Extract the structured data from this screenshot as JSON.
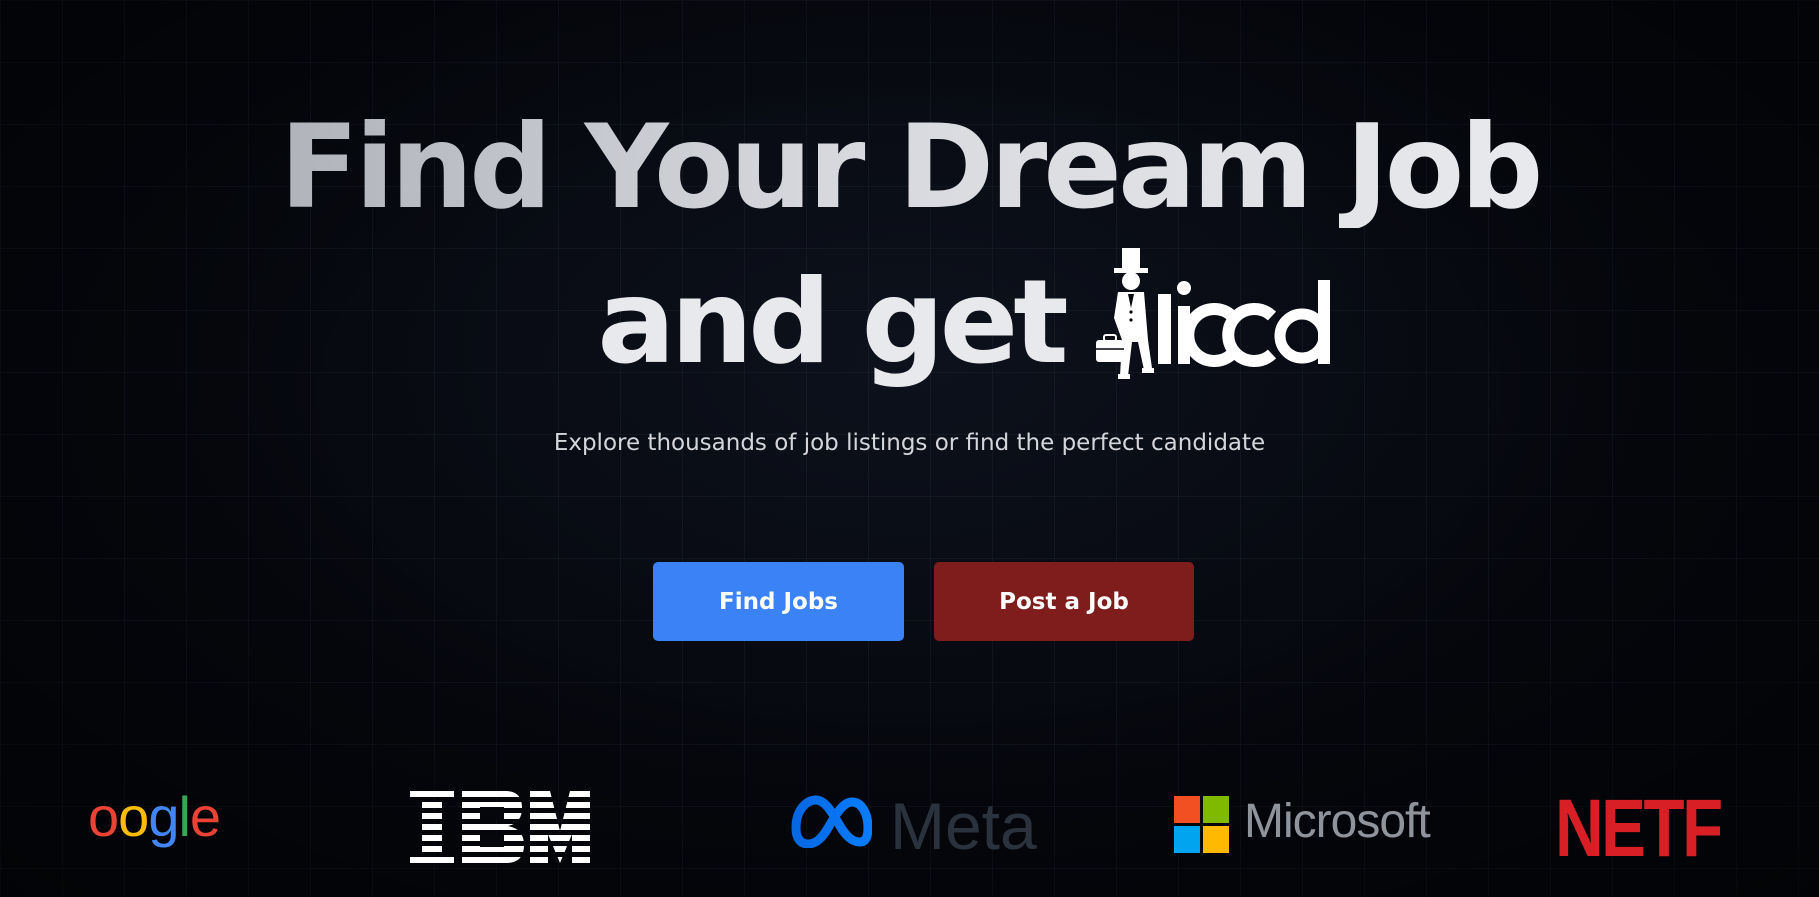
{
  "hero": {
    "headline_line1": "Find Your Dream Job",
    "headline_line2": "and get",
    "brand_name": "Hired",
    "subtitle": "Explore thousands of job listings or find the perfect candidate"
  },
  "buttons": {
    "find_jobs": "Find Jobs",
    "post_job": "Post a Job"
  },
  "colors": {
    "background": "#05070d",
    "find_jobs_bg": "#3b82f6",
    "post_job_bg": "#7f1d1d"
  },
  "company_logos": {
    "google": "oogle",
    "ibm": "IBM",
    "meta": "Meta",
    "microsoft": "Microsoft",
    "netflix": "NETFL"
  },
  "icons": {
    "brand": "top-hat-gentleman-with-briefcase-icon",
    "meta": "meta-infinity-icon",
    "microsoft": "microsoft-four-squares-icon"
  }
}
